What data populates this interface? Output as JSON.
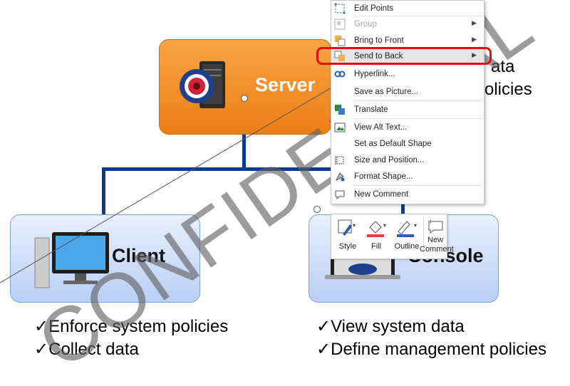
{
  "slide": {
    "server_label": "Server",
    "client_label": "Client",
    "console_label": "Console",
    "client_bullets": [
      "Enforce system policies",
      "Collect data"
    ],
    "console_bullets": [
      "View system data",
      "Define management policies"
    ],
    "top_right_text_1": "ata",
    "top_right_text_2": "olicies",
    "checkmark": "✓",
    "watermark": "CONFIDENTIAL"
  },
  "context_menu": {
    "items": [
      {
        "label": "Edit Points",
        "icon": "edit-points-icon",
        "submenu": false,
        "disabled": false
      },
      {
        "label": "Group",
        "icon": "group-icon",
        "submenu": true,
        "disabled": true
      },
      {
        "label": "Bring to Front",
        "icon": "bring-to-front-icon",
        "submenu": true,
        "disabled": false
      },
      {
        "label": "Send to Back",
        "icon": "send-to-back-icon",
        "submenu": true,
        "disabled": false,
        "highlighted": true
      },
      {
        "label": "Hyperlink...",
        "icon": "hyperlink-icon",
        "submenu": false,
        "disabled": false
      },
      {
        "label": "Save as Picture...",
        "icon": "",
        "submenu": false,
        "disabled": false
      },
      {
        "label": "Translate",
        "icon": "translate-icon",
        "submenu": false,
        "disabled": false
      },
      {
        "label": "View Alt Text...",
        "icon": "alt-text-icon",
        "submenu": false,
        "disabled": false
      },
      {
        "label": "Set as Default Shape",
        "icon": "",
        "submenu": false,
        "disabled": false
      },
      {
        "label": "Size and Position...",
        "icon": "size-position-icon",
        "submenu": false,
        "disabled": false
      },
      {
        "label": "Format Shape...",
        "icon": "format-shape-icon",
        "submenu": false,
        "disabled": false
      },
      {
        "label": "New Comment",
        "icon": "new-comment-icon",
        "submenu": false,
        "disabled": false
      }
    ]
  },
  "mini_toolbar": {
    "style_label": "Style",
    "fill_label": "Fill",
    "outline_label": "Outline",
    "new_comment_label_1": "New",
    "new_comment_label_2": "Comment"
  },
  "colors": {
    "server_orange": "#ee7e15",
    "connector_blue": "#0b3d8c",
    "highlight_red": "#e01010",
    "box_blue": "#b9cff5"
  }
}
